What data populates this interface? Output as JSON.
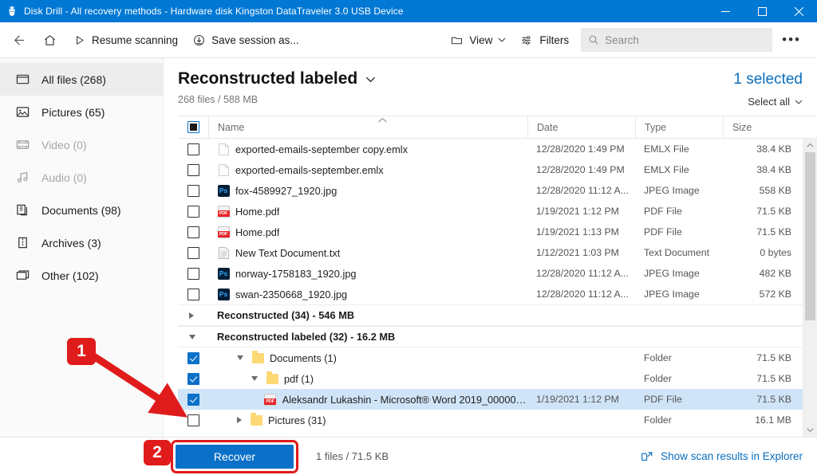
{
  "window": {
    "title": "Disk Drill - All recovery methods - Hardware disk Kingston DataTraveler 3.0 USB Device",
    "app_icon": "disk-drill-icon",
    "minimize_label": "—",
    "maximize_label": "□",
    "close_label": "✕",
    "accent_color": "#0078d4"
  },
  "toolbar": {
    "back_label": "",
    "home_label": "",
    "resume_label": "Resume scanning",
    "save_session_label": "Save session as...",
    "view_label": "View",
    "filters_label": "Filters",
    "more_label": "•••",
    "search": {
      "placeholder": "Search",
      "value": ""
    }
  },
  "sidebar": {
    "items": [
      {
        "label": "All files (268)",
        "icon": "all-files-icon",
        "active": true,
        "disabled": false
      },
      {
        "label": "Pictures (65)",
        "icon": "pictures-icon",
        "active": false,
        "disabled": false
      },
      {
        "label": "Video (0)",
        "icon": "video-icon",
        "active": false,
        "disabled": true
      },
      {
        "label": "Audio (0)",
        "icon": "audio-icon",
        "active": false,
        "disabled": true
      },
      {
        "label": "Documents (98)",
        "icon": "documents-icon",
        "active": false,
        "disabled": false
      },
      {
        "label": "Archives (3)",
        "icon": "archives-icon",
        "active": false,
        "disabled": false
      },
      {
        "label": "Other (102)",
        "icon": "other-icon",
        "active": false,
        "disabled": false
      }
    ]
  },
  "main": {
    "title": "Reconstructed labeled",
    "subtitle": "268 files / 588 MB",
    "selected_count": "1 selected",
    "select_all": "Select all",
    "selected_color": "#0a6ebd"
  },
  "table": {
    "columns": {
      "name": "Name",
      "date": "Date",
      "type": "Type",
      "size": "Size"
    },
    "header_checkbox_state": "indeterminate",
    "sort_indicator": "˄",
    "rows": [
      {
        "kind": "file",
        "checked": false,
        "icon": "generic-file-icon",
        "name": "exported-emails-september copy.emlx",
        "date": "12/28/2020 1:49 PM",
        "type": "EMLX File",
        "size": "38.4 KB",
        "indent": 0,
        "selected": false
      },
      {
        "kind": "file",
        "checked": false,
        "icon": "generic-file-icon",
        "name": "exported-emails-september.emlx",
        "date": "12/28/2020 1:49 PM",
        "type": "EMLX File",
        "size": "38.4 KB",
        "indent": 0,
        "selected": false
      },
      {
        "kind": "file",
        "checked": false,
        "icon": "photoshop-icon",
        "name": "fox-4589927_1920.jpg",
        "date": "12/28/2020 11:12 A...",
        "type": "JPEG Image",
        "size": "558 KB",
        "indent": 0,
        "selected": false
      },
      {
        "kind": "file",
        "checked": false,
        "icon": "pdf-icon",
        "name": "Home.pdf",
        "date": "1/19/2021 1:12 PM",
        "type": "PDF File",
        "size": "71.5 KB",
        "indent": 0,
        "selected": false
      },
      {
        "kind": "file",
        "checked": false,
        "icon": "pdf-icon",
        "name": "Home.pdf",
        "date": "1/19/2021 1:13 PM",
        "type": "PDF File",
        "size": "71.5 KB",
        "indent": 0,
        "selected": false
      },
      {
        "kind": "file",
        "checked": false,
        "icon": "text-file-icon",
        "name": "New Text Document.txt",
        "date": "1/12/2021 1:03 PM",
        "type": "Text Document",
        "size": "0 bytes",
        "indent": 0,
        "selected": false
      },
      {
        "kind": "file",
        "checked": false,
        "icon": "photoshop-icon",
        "name": "norway-1758183_1920.jpg",
        "date": "12/28/2020 11:12 A...",
        "type": "JPEG Image",
        "size": "482 KB",
        "indent": 0,
        "selected": false
      },
      {
        "kind": "file",
        "checked": false,
        "icon": "photoshop-icon",
        "name": "swan-2350668_1920.jpg",
        "date": "12/28/2020 11:12 A...",
        "type": "JPEG Image",
        "size": "572 KB",
        "indent": 0,
        "selected": false
      },
      {
        "kind": "group",
        "expanded": false,
        "name": "Reconstructed (34) - 546 MB",
        "date": "",
        "type": "",
        "size": "",
        "indent": 0,
        "selected": false
      },
      {
        "kind": "group",
        "expanded": true,
        "name": "Reconstructed labeled (32) - 16.2 MB",
        "date": "",
        "type": "",
        "size": "",
        "indent": 0,
        "selected": false
      },
      {
        "kind": "folder",
        "checked": true,
        "expanded": true,
        "icon": "folder-icon",
        "name": "Documents (1)",
        "date": "",
        "type": "Folder",
        "size": "71.5 KB",
        "indent": 1,
        "selected": false
      },
      {
        "kind": "folder",
        "checked": true,
        "expanded": true,
        "icon": "folder-icon",
        "name": "pdf (1)",
        "date": "",
        "type": "Folder",
        "size": "71.5 KB",
        "indent": 2,
        "selected": false
      },
      {
        "kind": "file",
        "checked": true,
        "icon": "pdf-icon",
        "name": "Aleksandr Lukashin - Microsoft® Word 2019_000000.p...",
        "date": "1/19/2021 1:12 PM",
        "type": "PDF File",
        "size": "71.5 KB",
        "indent": 3,
        "selected": true
      },
      {
        "kind": "folder",
        "checked": false,
        "expanded": false,
        "icon": "folder-icon",
        "name": "Pictures (31)",
        "date": "",
        "type": "Folder",
        "size": "16.1 MB",
        "indent": 1,
        "selected": false
      }
    ]
  },
  "footer": {
    "recover_label": "Recover",
    "info": "1 files / 71.5 KB",
    "explorer_link": "Show scan results in Explorer",
    "link_color": "#0a6ebd"
  },
  "annotations": {
    "badge_color": "#e01b1b",
    "items": [
      {
        "label": "1",
        "target": "selected-row-checkbox"
      },
      {
        "label": "2",
        "target": "recover-button"
      }
    ]
  }
}
